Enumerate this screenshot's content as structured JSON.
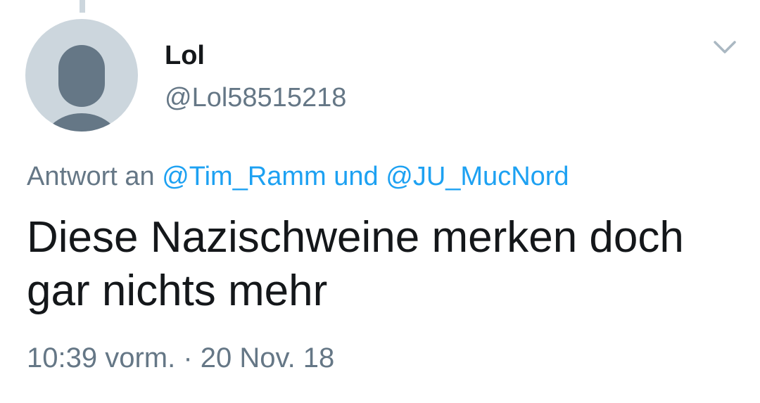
{
  "tweet": {
    "author": {
      "display_name": "Lol",
      "handle": "@Lol58515218",
      "avatar_icon": "default-profile-icon"
    },
    "reply": {
      "prefix": "Antwort an",
      "mentions": [
        "@Tim_Ramm",
        "@JU_MucNord"
      ],
      "joiner": "und"
    },
    "text": "Diese Nazischweine merken doch gar nichts mehr",
    "time": "10:39 vorm.",
    "separator": "·",
    "date": "20 Nov. 18",
    "menu_icon": "chevron-down-icon"
  },
  "colors": {
    "text_primary": "#14171a",
    "text_secondary": "#657786",
    "link": "#1da1f2",
    "avatar_bg": "#ccd6dd",
    "avatar_fg": "#657786",
    "chevron": "#aab8c2"
  }
}
